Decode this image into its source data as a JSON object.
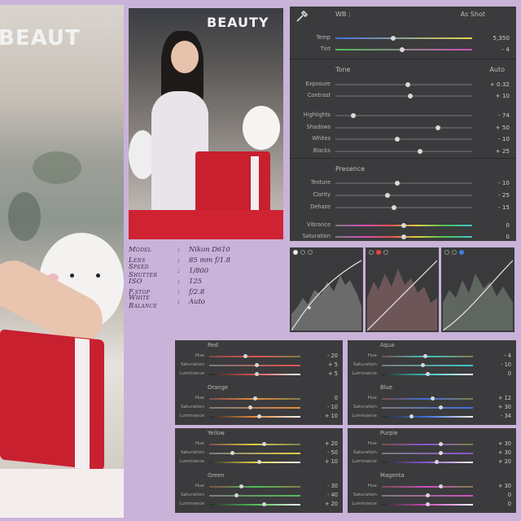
{
  "photo_left": {
    "sign_text": "BEAUT"
  },
  "photo_main": {
    "sign_text": "BEAUTY"
  },
  "metadata": [
    {
      "key": "Model",
      "value": "Nikon D610"
    },
    {
      "key": "Lens",
      "value": "85 mm f/1.8"
    },
    {
      "key": "Speed Shutter",
      "value": "1/800"
    },
    {
      "key": "ISO",
      "value": "125"
    },
    {
      "key": "F.stop",
      "value": "f/2.8"
    },
    {
      "key": "White Balance",
      "value": "Auto"
    }
  ],
  "basic": {
    "wb_label": "WB :",
    "wb_value": "As Shot",
    "temp": {
      "label": "Temp",
      "value": "5,350",
      "level": 0.42
    },
    "tint": {
      "label": "Tint",
      "value": "- 4",
      "level": 0.49
    },
    "tone_header": "Tone",
    "tone_auto": "Auto",
    "exposure": {
      "label": "Exposure",
      "value": "+ 0.32",
      "level": 0.53
    },
    "contrast": {
      "label": "Contrast",
      "value": "+ 10",
      "level": 0.55
    },
    "highlights": {
      "label": "Highlights",
      "value": "- 74",
      "level": 0.13
    },
    "shadows": {
      "label": "Shadows",
      "value": "+ 50",
      "level": 0.75
    },
    "whites": {
      "label": "Whites",
      "value": "- 10",
      "level": 0.45
    },
    "blacks": {
      "label": "Blacks",
      "value": "+ 25",
      "level": 0.62
    },
    "presence_header": "Presence",
    "texture": {
      "label": "Texture",
      "value": "- 10",
      "level": 0.45
    },
    "clarity": {
      "label": "Clarity",
      "value": "- 25",
      "level": 0.38
    },
    "dehaze": {
      "label": "Dehaze",
      "value": "- 15",
      "level": 0.43
    },
    "vibrance": {
      "label": "Vibrance",
      "value": "0",
      "level": 0.5
    },
    "saturation": {
      "label": "Saturation",
      "value": "0",
      "level": 0.5
    }
  },
  "hsl": [
    {
      "name": "Red",
      "hue": "- 20",
      "hue_level": 0.4,
      "sat": "+ 5",
      "sat_level": 0.52,
      "lum": "+ 5",
      "lum_level": 0.52
    },
    {
      "name": "Aqua",
      "hue": "- 4",
      "hue_level": 0.48,
      "sat": "- 10",
      "sat_level": 0.45,
      "lum": "0",
      "lum_level": 0.5
    },
    {
      "name": "Orange",
      "hue": "0",
      "hue_level": 0.5,
      "sat": "- 10",
      "sat_level": 0.45,
      "lum": "+ 10",
      "lum_level": 0.55
    },
    {
      "name": "Blue",
      "hue": "+ 12",
      "hue_level": 0.56,
      "sat": "+ 30",
      "sat_level": 0.65,
      "lum": "- 34",
      "lum_level": 0.33
    },
    {
      "name": "Yellow",
      "hue": "+ 20",
      "hue_level": 0.6,
      "sat": "- 50",
      "sat_level": 0.25,
      "lum": "+ 10",
      "lum_level": 0.55
    },
    {
      "name": "Purple",
      "hue": "+ 30",
      "hue_level": 0.65,
      "sat": "+ 30",
      "sat_level": 0.65,
      "lum": "+ 20",
      "lum_level": 0.6
    },
    {
      "name": "Green",
      "hue": "- 30",
      "hue_level": 0.35,
      "sat": "- 40",
      "sat_level": 0.3,
      "lum": "+ 20",
      "lum_level": 0.6
    },
    {
      "name": "Magenta",
      "hue": "+ 30",
      "hue_level": 0.65,
      "sat": "0",
      "sat_level": 0.5,
      "lum": "0",
      "lum_level": 0.5
    }
  ],
  "hsl_labels": {
    "hue": "Hue",
    "sat": "Saturation",
    "lum": "Luminance"
  },
  "colors": {
    "page_bg": "#c9b3d9",
    "panel_bg": "#3b3b3d",
    "hsl_red": "#e2534f",
    "hsl_orange": "#e98b3a",
    "hsl_yellow": "#e1cf46",
    "hsl_green": "#4fbf57",
    "hsl_aqua": "#3fc7c9",
    "hsl_blue": "#3f6fe0",
    "hsl_purple": "#8a56d8",
    "hsl_magenta": "#d04fbf"
  },
  "curves": [
    {
      "channel": "rgb",
      "icon": "curve-rgb-icon"
    },
    {
      "channel": "red",
      "icon": "curve-red-icon"
    },
    {
      "channel": "blue",
      "icon": "curve-blue-icon"
    }
  ]
}
